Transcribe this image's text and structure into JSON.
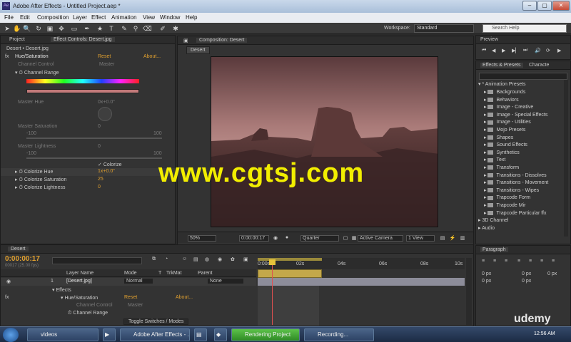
{
  "window": {
    "title": "Adobe After Effects - Untitled Project.aep *",
    "app_icon": "Ae"
  },
  "menu": [
    "File",
    "Edit",
    "Composition",
    "Layer",
    "Effect",
    "Animation",
    "View",
    "Window",
    "Help"
  ],
  "toolbar": {
    "workspace_label": "Workspace:",
    "workspace_value": "Standard",
    "search_placeholder": "Search Help"
  },
  "project_tabs": {
    "project": "Project",
    "effect_controls": "Effect Controls: Desert.jpg"
  },
  "effect_controls": {
    "breadcrumb": "Desert • Desert.jpg",
    "effect_name": "Hue/Saturation",
    "reset": "Reset",
    "about": "About...",
    "channel_control_label": "Channel Control",
    "channel_control_value": "Master",
    "channel_range": "Channel Range",
    "master_hue": "Master Hue",
    "master_hue_value": "0x+0.0°",
    "master_saturation": "Master Saturation",
    "master_saturation_value": "0",
    "sat_min": "-100",
    "sat_max": "100",
    "master_lightness": "Master Lightness",
    "master_lightness_value": "0",
    "light_min": "-100",
    "light_max": "100",
    "colorize": "Colorize",
    "colorize_hue": "Colorize Hue",
    "colorize_hue_value": "1x+0.0°",
    "colorize_saturation": "Colorize Saturation",
    "colorize_saturation_value": "25",
    "colorize_lightness": "Colorize Lightness",
    "colorize_lightness_value": "0"
  },
  "composition": {
    "tab": "Composition: Desert",
    "sub_tab": "Desert",
    "zoom": "50%",
    "timecode": "0:00:00:17",
    "resolution": "Quarter",
    "camera": "Active Camera",
    "views": "1 View"
  },
  "watermark": "www.cgtsj.com",
  "preview": {
    "tab": "Preview"
  },
  "effects_presets": {
    "tab": "Effects & Presets",
    "tab2": "Characte",
    "root": "* Animation Presets",
    "items": [
      "Backgrounds",
      "Behaviors",
      "Image - Creative",
      "Image - Special Effects",
      "Image - Utilities",
      "Mojo Presets",
      "Shapes",
      "Sound Effects",
      "Synthetics",
      "Text",
      "Transform",
      "Transitions - Dissolves",
      "Transitions - Movement",
      "Transitions - Wipes",
      "Trapcode Form",
      "Trapcode Mir",
      "Trapcode Particular ffx"
    ],
    "bottom_items": [
      "3D Channel",
      "Audio"
    ]
  },
  "paragraph": {
    "tab": "Paragraph",
    "px": "px",
    "fields": [
      "0 px",
      "0 px",
      "0 px",
      "0 px",
      "0 px"
    ]
  },
  "timeline": {
    "tab": "Desert",
    "timecode": "0:00:00:17",
    "frame_info": "00017 (25.00 fps)",
    "columns": [
      "Layer Name",
      "Mode",
      "T",
      "TrkMat",
      "Parent"
    ],
    "layer": {
      "index": "1",
      "name": "[Desert.jpg]",
      "mode": "Normal",
      "parent": "None"
    },
    "rows": {
      "effects": "Effects",
      "hue": "Hue/Saturation",
      "reset": "Reset",
      "about": "About...",
      "channel_control": "Channel Control",
      "channel_control_value": "Master",
      "channel_range": "Channel Range"
    },
    "ruler": [
      "0:00s",
      "02s",
      "04s",
      "06s",
      "08s",
      "10s"
    ],
    "toggle": "Toggle Switches / Modes"
  },
  "taskbar": {
    "items": [
      "videos",
      "Adobe After Effects - ...",
      "Rendering Project",
      "Recording..."
    ],
    "clock": "12:56 AM",
    "brand": "udemy"
  }
}
